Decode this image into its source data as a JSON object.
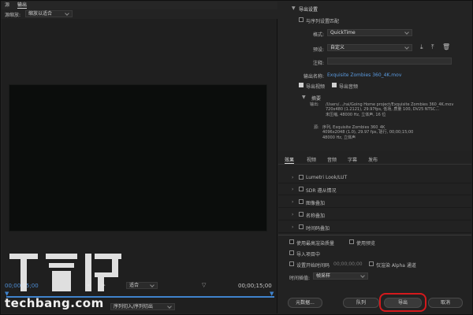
{
  "left": {
    "tabs": [
      {
        "label": "源"
      },
      {
        "label": "输出"
      }
    ],
    "scale_label": "源缩放:",
    "scale_value": "缩放以适合",
    "timecode_start": "00;00;15;00",
    "fit_value": "适合",
    "timecode_end": "00;00;15;00",
    "source_range_value": "序列切入/序列切出"
  },
  "export_settings": {
    "section_title": "导出设置",
    "match_sequence": "与序列设置匹配",
    "format_label": "格式:",
    "format_value": "QuickTime",
    "preset_label": "预设:",
    "preset_value": "自定义",
    "comment_label": "注释:",
    "comment_value": "",
    "output_name_label": "输出名称:",
    "output_name_value": "Exquisite Zombies 360_4K.mov",
    "export_video": "导出视频",
    "export_audio": "导出音频",
    "summary_title": "摘要",
    "summary_output_label": "输出:",
    "summary_output_lines": [
      "/Users/.../rai/Going Home project/Exquisite Zombies 360_4K.mov",
      "720x480 (1.2121), 29.97fps, 低场, 质量 100, DV25 NTSC...",
      "未压缩, 48000 Hz, 立体声, 16 位"
    ],
    "summary_source_label": "源:",
    "summary_source_lines": [
      "序列, Exquisite Zombies 360_4K",
      "4096x2048 (1.0), 29.97 fps, 逐行, 00;00;15;00",
      "48000 Hz, 立体声"
    ]
  },
  "tabs2": [
    {
      "label": "效果"
    },
    {
      "label": "视频"
    },
    {
      "label": "音频"
    },
    {
      "label": "字幕"
    },
    {
      "label": "发布"
    }
  ],
  "effects": [
    {
      "label": "Lumetri Look/LUT"
    },
    {
      "label": "SDR 遵从情况"
    },
    {
      "label": "图像叠加"
    },
    {
      "label": "名称叠加"
    },
    {
      "label": "时间码叠加"
    }
  ],
  "options": {
    "max_render_quality": "使用最高渲染质量",
    "use_previews": "使用预览",
    "import_project": "导入项目中",
    "set_start_timecode": "设置开始时间码",
    "start_timecode_value": "00;00;00;00",
    "render_alpha": "仅渲染 Alpha 通道",
    "time_interp_label": "时间插值:",
    "time_interp_value": "帧采样"
  },
  "buttons": {
    "metadata": "元数据...",
    "queue": "队列",
    "export": "导出",
    "cancel": "取消"
  },
  "watermark": {
    "line1": "T客邦",
    "line2": "techbang.com"
  },
  "colors": {
    "accent_blue": "#3f83cc",
    "highlight_red": "#d4191c"
  }
}
